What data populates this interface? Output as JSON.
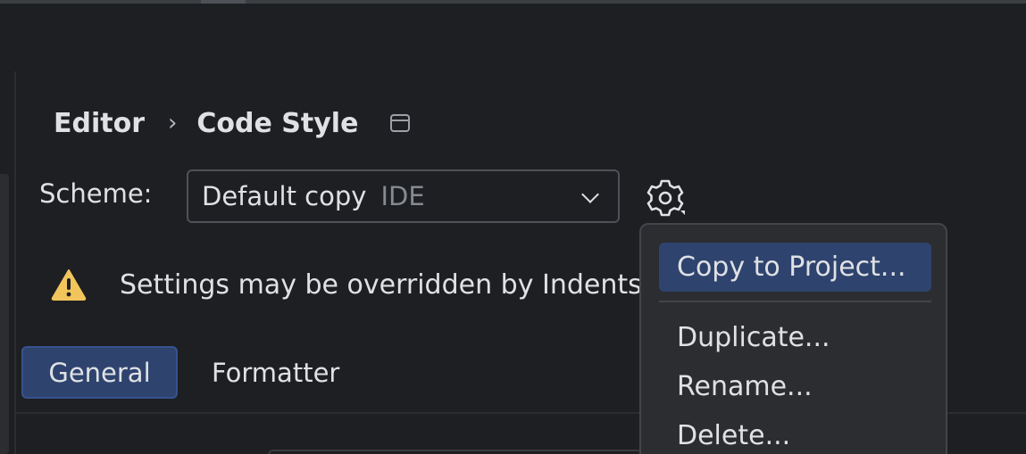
{
  "breadcrumb": {
    "parent": "Editor",
    "separator": "›",
    "current": "Code Style"
  },
  "scheme": {
    "label": "Scheme:",
    "value": "Default copy",
    "tag": "IDE"
  },
  "warning": {
    "text": "Settings may be overridden by Indents"
  },
  "tabs": [
    {
      "label": "General",
      "active": true
    },
    {
      "label": "Formatter",
      "active": false
    }
  ],
  "scheme_menu": {
    "items": [
      {
        "label": "Copy to Project...",
        "selected": true
      },
      {
        "label": "Duplicate...",
        "selected": false
      },
      {
        "label": "Rename...",
        "selected": false
      },
      {
        "label": "Delete...",
        "selected": false
      }
    ]
  },
  "icons": {
    "window": "window-icon",
    "dropdown": "chevron-down-icon",
    "settings": "gear-icon",
    "warning": "warning-triangle-icon"
  },
  "colors": {
    "background": "#1e1f22",
    "accent": "#2e436e",
    "warning": "#f2c55c",
    "text": "#dfe1e5",
    "muted": "#868a91"
  }
}
